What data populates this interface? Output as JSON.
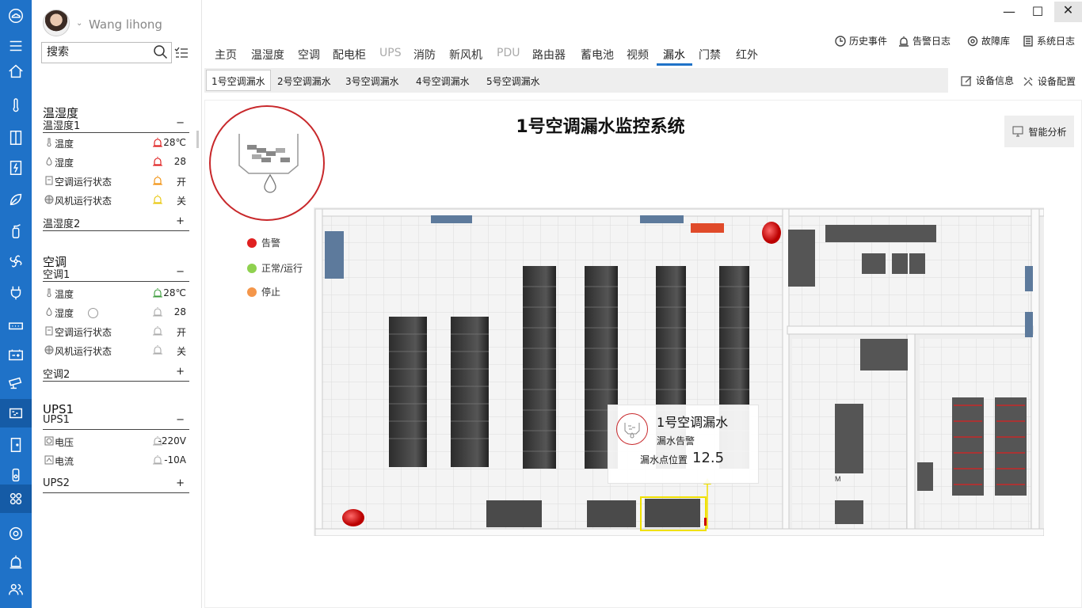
{
  "user": {
    "name": "Wang lihong"
  },
  "search": {
    "placeholder": "搜索"
  },
  "left_panel": {
    "sections": [
      {
        "title": "温湿度",
        "group1": {
          "name": "温湿度1",
          "toggle": "−",
          "items": [
            {
              "label": "温度",
              "value": "28℃",
              "icon": "thermometer-icon",
              "alarm_color": "#d11"
            },
            {
              "label": "湿度",
              "value": "28",
              "icon": "droplet-icon",
              "alarm_color": "#d11"
            },
            {
              "label": "空调运行状态",
              "value": "开",
              "icon": "ac-icon",
              "alarm_color": "#f08a00"
            },
            {
              "label": "风机运行状态",
              "value": "关",
              "icon": "fan-icon",
              "alarm_color": "#e8c400"
            }
          ]
        },
        "group2": {
          "name": "温湿度2",
          "toggle": "+"
        }
      },
      {
        "title": "空调",
        "group1": {
          "name": "空调1",
          "toggle": "−",
          "items": [
            {
              "label": "温度",
              "value": "28℃",
              "icon": "thermometer-icon",
              "alarm_color": "#3a9a3a"
            },
            {
              "label": "湿度",
              "value": "28",
              "icon": "droplet-icon",
              "alarm_color": "#aaa"
            },
            {
              "label": "空调运行状态",
              "value": "开",
              "icon": "ac-icon",
              "alarm_color": "#aaa"
            },
            {
              "label": "风机运行状态",
              "value": "关",
              "icon": "fan-icon",
              "alarm_color": "#aaa"
            }
          ]
        },
        "group2": {
          "name": "空调2",
          "toggle": "+"
        }
      },
      {
        "title": "UPS1",
        "group1": {
          "name": "UPS1",
          "toggle": "−",
          "items": [
            {
              "label": "电压",
              "value": "-220V",
              "icon": "voltage-icon",
              "alarm_color": "#aaa"
            },
            {
              "label": "电流",
              "value": "-10A",
              "icon": "current-icon",
              "alarm_color": "#aaa"
            }
          ]
        },
        "group2": {
          "name": "UPS2",
          "toggle": "+"
        }
      }
    ]
  },
  "tabs": [
    "主页",
    "温湿度",
    "空调",
    "配电柜",
    "UPS",
    "消防",
    "新风机",
    "PDU",
    "路由器",
    "蓄电池",
    "视频",
    "漏水",
    "门禁",
    "红外"
  ],
  "active_tab": "漏水",
  "top_links": [
    "历史事件",
    "告警日志",
    "故障库",
    "系统日志"
  ],
  "subtabs": [
    "1号空调漏水",
    "2号空调漏水",
    "3号空调漏水",
    "4号空调漏水",
    "5号空调漏水"
  ],
  "right_buttons": [
    "设备信息",
    "设备配置"
  ],
  "main": {
    "title": "1号空调漏水监控系统",
    "analysis": "智能分析",
    "legend": [
      {
        "label": "告警",
        "color": "#e02020"
      },
      {
        "label": "正常/运行",
        "color": "#8fd14f"
      },
      {
        "label": "停止",
        "color": "#f4964a"
      }
    ],
    "tooltip": {
      "title": "1号空调漏水",
      "status": "漏水告警",
      "pos_label": "漏水点位置",
      "pos_value": "12.5"
    },
    "room_label": "M"
  },
  "window": {
    "min": "—",
    "max": "☐",
    "close": "✕"
  }
}
